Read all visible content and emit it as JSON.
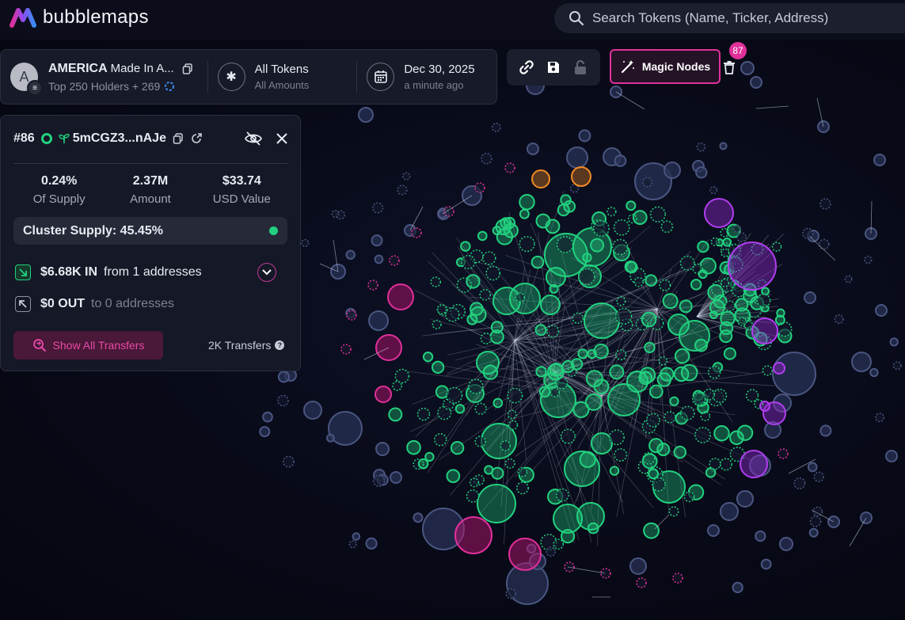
{
  "app": {
    "logo_text": "bubblemaps",
    "search_placeholder": "Search Tokens (Name, Ticker, Address)"
  },
  "token_bar": {
    "avatar_letter": "A",
    "token_name": "AMERICA",
    "token_subname": "Made In A...",
    "holders_text": "Top 250 Holders + 269",
    "filter_title": "All Tokens",
    "filter_sub": "All Amounts",
    "date": "Dec 30, 2025",
    "date_relative": "a minute ago"
  },
  "toolbar": {
    "magic_label": "Magic Nodes",
    "magic_count": "87"
  },
  "detail": {
    "rank": "#86",
    "address": "5mCGZ3...nAJe",
    "stats": [
      {
        "value": "0.24%",
        "label": "Of Supply"
      },
      {
        "value": "2.37M",
        "label": "Amount"
      },
      {
        "value": "$33.74",
        "label": "USD Value"
      }
    ],
    "cluster_supply": "Cluster Supply: 45.45%",
    "in_amount": "$6.68K IN",
    "in_text": "from 1 addresses",
    "out_amount": "$0 OUT",
    "out_text": "to 0 addresses",
    "show_all_label": "Show All Transfers",
    "transfers_count": "2K Transfers"
  },
  "colors": {
    "green": "#22d17f",
    "magenta": "#e0309a",
    "purple": "#b03ef0",
    "slate": "#5a6b9a",
    "orange": "#f08a24"
  }
}
